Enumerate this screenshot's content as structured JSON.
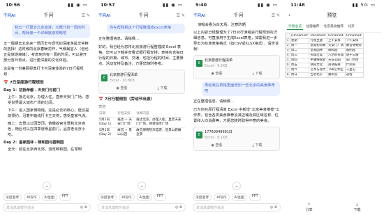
{
  "app": {
    "logo": "千问AI"
  },
  "screen1": {
    "time": "10:56",
    "title": "千问",
    "user_msg": "我五一打算去北京旅游，大概计划一周的时间，帮我做一个详细旅游攻略吧",
    "intro": "五一假期去北京来一场历史与现代的深度游是非常棒的选择！这时候的北京春暖花开，气候最宜人（但也正是旅游高峰），考虑到你有一周的时间，可以避开部分冒日热点，进行更深度的文化体验。",
    "intro2": "这是有一份兼顾经典打卡与深度体验的7日行程规划：",
    "heading": "📅 7日深度游行程规划",
    "day1": "Day 1：初抵帝都 - 天安门与前门",
    "d1_bullets": [
      "上午：抵达北京，办理入住。直奔天安门广场，感受世界最大城市广场的壮阔。",
      "下午：进入国家博物馆。这是必去的核心。建议提前预约，沿着中轴线打卡王天将，感受皇家气派。",
      "晚上：去景山公园登顶，俯瞰故宫全景和北京夜色，随后可以在四季道明星前门，品尝老北京小吃。"
    ],
    "day2": "Day 2：皇家园林 - 颐和园与圆明园",
    "d2_bullets": [
      "全天：前往北京西北郊，游览颐和园，在昆明"
    ]
  },
  "screen2": {
    "time": "10:57",
    "title": "千问",
    "user_msg": "你先帮我把这个行程整理成excel表格",
    "para": "正在整理信息，请稍候...",
    "para2": "好的，我已经为您将北京旅游行程整理成 Excel 表格。您可以下载并查看详细行程安排。表格包含每日行程的日期、城市、交通，包括行程的时间、主要景点、活动安排及备注，方便您随时参考。",
    "para3": "我已经为您将北京旅游行程整理成Excel表格，方便您查看和使用。已根据您的行程安排，详细列出了每天的活动、路线、交通和注意事项，方便您快速查看。",
    "file_name": "北京旅游行程清单",
    "file_sub": "Excel · 10.8KB",
    "view": "查看",
    "download": "下载",
    "heading": "📅 7日行程规划（劳动节出游）",
    "table_label": "表格",
    "cols": [
      "日期",
      "行程安排",
      "详细内容"
    ],
    "rows": [
      [
        "5月1日 (Day 1)",
        "抵达 + 天安门广场",
        "抵达北京，办理入住，直奔天安门广场，感受城市广场"
      ],
      [
        "5月2日 (Day 2)",
        "故宫 + 景山公园",
        "故宫博物院深度游，登景山俯瞰全景"
      ]
    ]
  },
  "screen3": {
    "time": "9:40",
    "title": "千问",
    "top_bullets": [
      "演唱会看为白天场，注意防晒"
    ],
    "para": "以上内容已经整理为了7日对行演唱会行程规划的详细信息。可直接用于生成Excel表格，如需我进一步导出为标准表格格式（如CSV或XLSX格式），请告诉我！",
    "file_name": "北京旅游行程清单",
    "file_sub": "Excel · 9.2KB",
    "view": "查看",
    "download": "下载",
    "user_msg": "再给我在表格里面增加一些北京的美食推荐吧",
    "para2": "正在整理信息，请稍候...",
    "para3": "已为你在原行程清单 Excel 中新增“北京美食推荐”工作表，包含各类美食推荐及其店铺及其区域名称、位置和人均消费等，方便您随时取得中意的美食。",
    "file2_name": "17760949691l3",
    "file2_sub": "Excel · 8.1KB",
    "view2": "查看",
    "download2": "下载"
  },
  "screen4": {
    "time": "11:48",
    "title": "预览",
    "tabs": [
      "行程总览",
      "住宿推荐",
      "北京美食推荐",
      "北京"
    ],
    "active_tab": 0,
    "header_row": [
      "(Unnamed:",
      "Unnamed:",
      "Unnamed:",
      "Unnamed:"
    ],
    "rows": [
      [
        "1",
        "星期",
        "行程主题",
        "上午安排",
        "下午安排"
      ],
      [
        "2",
        "周一",
        "皇城初印象",
        "天安门广场",
        "故宫博物院"
      ],
      [
        "3",
        "周二",
        "皇家园林",
        "颐和园",
        "圆明园"
      ],
      [
        "4",
        "周三",
        "长城壮美",
        "八达岭长城",
        "明十三陵"
      ],
      [
        "5",
        "周四",
        "中轴线探索",
        "天坛公园",
        "前门大街"
      ],
      [
        "6",
        "周五",
        "胡同文化",
        "南锣鼓巷",
        "什刹海"
      ],
      [
        "7",
        "周六",
        "艺术与现代",
        "798艺术区",
        "三里屯"
      ],
      [
        "8",
        "周日",
        "告别北京",
        "雍和宫",
        "返程"
      ]
    ],
    "share": "分享",
    "download": "下载"
  },
  "common": {
    "chips": [
      "深度思考",
      "AI写作",
      "AI生图",
      "PPT"
    ],
    "input_placeholder": "发消息或按住说话"
  }
}
